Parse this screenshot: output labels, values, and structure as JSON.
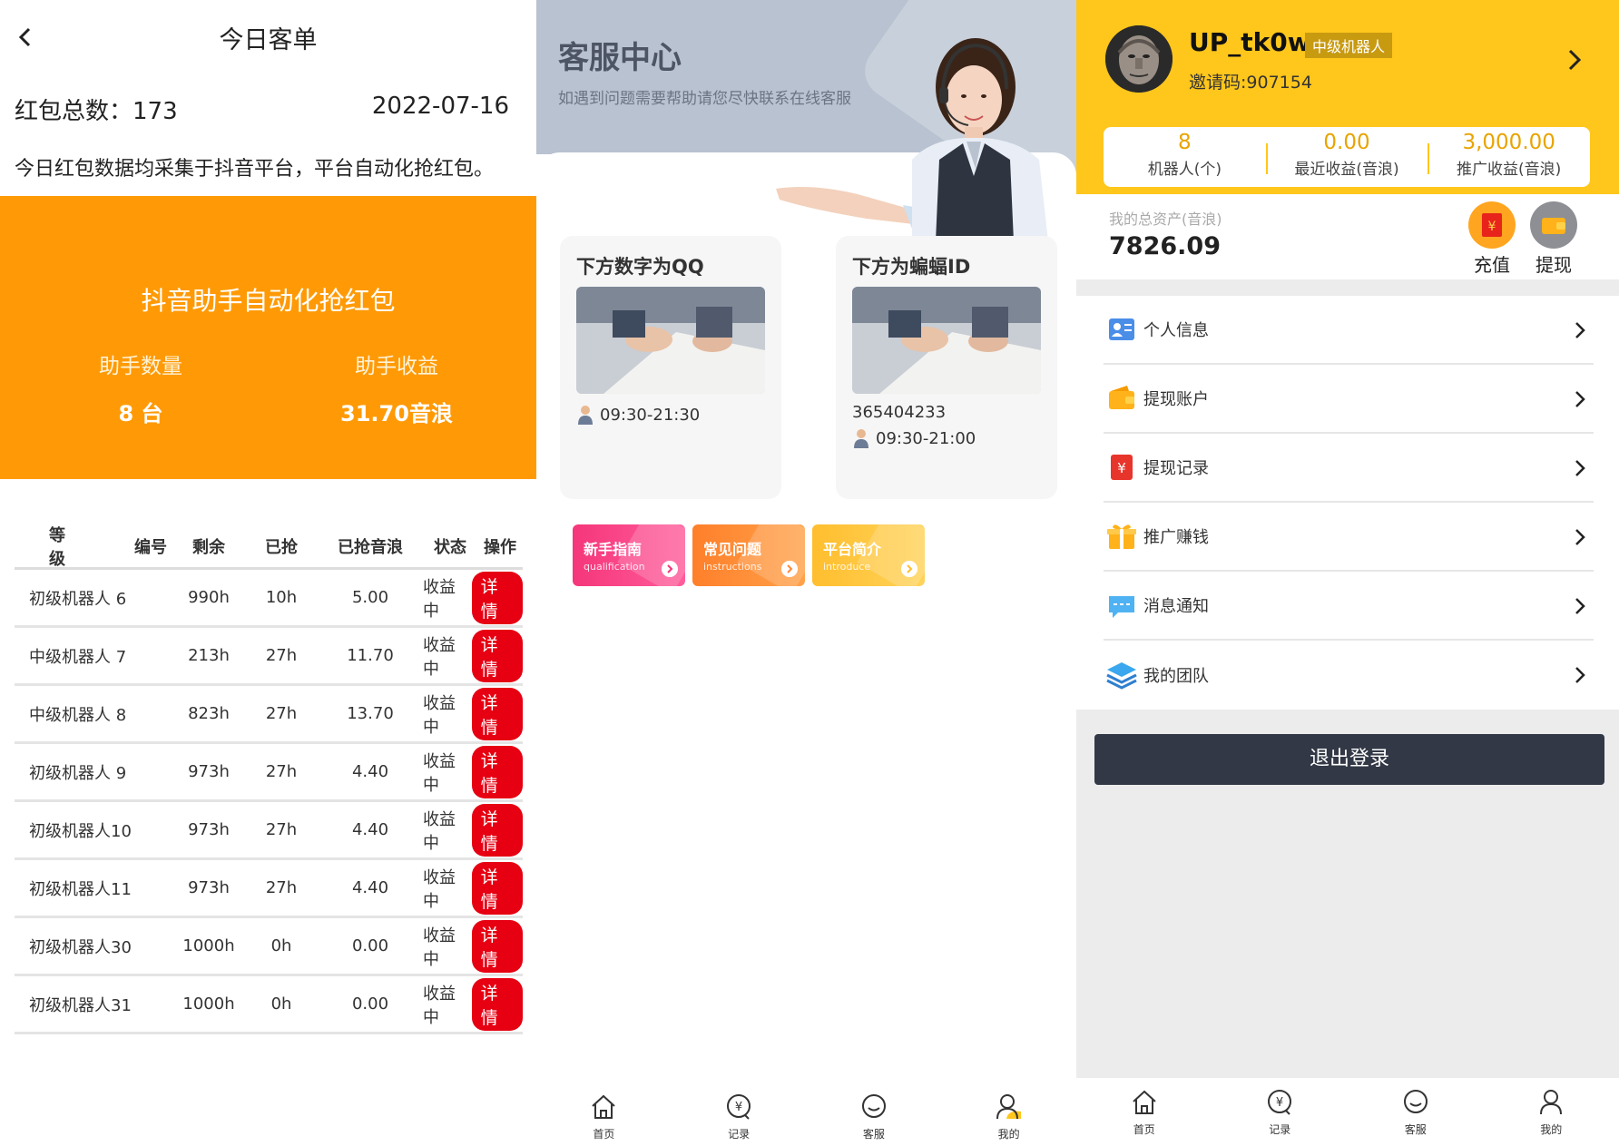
{
  "panel1": {
    "title": "今日客单",
    "total_label": "红包总数：173",
    "date": "2022-07-16",
    "note": "今日红包数据均采集于抖音平台，平台自动化抢红包。",
    "banner": {
      "title": "抖音助手自动化抢红包",
      "count_label": "助手数量",
      "count_value": "8 台",
      "income_label": "助手收益",
      "income_value": "31.70音浪"
    },
    "table": {
      "headers": [
        "等级",
        "编号",
        "剩余",
        "已抢",
        "已抢音浪",
        "状态",
        "操作"
      ],
      "rows": [
        {
          "level": "初级机器人 6",
          "remain": "990h",
          "got": "10h",
          "amount": "5.00",
          "status": "收益中",
          "op": "详情"
        },
        {
          "level": "中级机器人 7",
          "remain": "213h",
          "got": "27h",
          "amount": "11.70",
          "status": "收益中",
          "op": "详情"
        },
        {
          "level": "中级机器人 8",
          "remain": "823h",
          "got": "27h",
          "amount": "13.70",
          "status": "收益中",
          "op": "详情"
        },
        {
          "level": "初级机器人 9",
          "remain": "973h",
          "got": "27h",
          "amount": "4.40",
          "status": "收益中",
          "op": "详情"
        },
        {
          "level": "初级机器人10",
          "remain": "973h",
          "got": "27h",
          "amount": "4.40",
          "status": "收益中",
          "op": "详情"
        },
        {
          "level": "初级机器人11",
          "remain": "973h",
          "got": "27h",
          "amount": "4.40",
          "status": "收益中",
          "op": "详情"
        },
        {
          "level": "初级机器人30",
          "remain": "1000h",
          "got": "0h",
          "amount": "0.00",
          "status": "收益中",
          "op": "详情"
        },
        {
          "level": "初级机器人31",
          "remain": "1000h",
          "got": "0h",
          "amount": "0.00",
          "status": "收益中",
          "op": "详情"
        }
      ]
    }
  },
  "panel2": {
    "title": "客服中心",
    "subtitle": "如遇到问题需要帮助请您尽快联系在线客服",
    "card_qq": {
      "title": "下方数字为QQ",
      "hours": "09:30-21:30"
    },
    "card_bat": {
      "title": "下方为蝙蝠ID",
      "id": "365404233",
      "hours": "09:30-21:00"
    },
    "tiles": [
      {
        "title": "新手指南",
        "sub": "qualification",
        "color": "#f5367a"
      },
      {
        "title": "常见问题",
        "sub": "instructions",
        "color": "#ff8a3a"
      },
      {
        "title": "平台简介",
        "sub": "introduce",
        "color": "#ffc53d"
      }
    ],
    "tabs": [
      {
        "label": "首页",
        "icon": "home-icon"
      },
      {
        "label": "记录",
        "icon": "yuan-record-icon"
      },
      {
        "label": "客服",
        "icon": "chat-bubble-icon"
      },
      {
        "label": "我的",
        "icon": "user-icon"
      }
    ]
  },
  "panel3": {
    "username": "UP_tk0w",
    "level": "中级机器人",
    "invite": "邀请码:907154",
    "stats": [
      {
        "value": "8",
        "label": "机器人(个)"
      },
      {
        "value": "0.00",
        "label": "最近收益(音浪)"
      },
      {
        "value": "3,000.00",
        "label": "推广收益(音浪)"
      }
    ],
    "assets_label": "我的总资产(音浪)",
    "assets_value": "7826.09",
    "recharge_label": "充值",
    "withdraw_label": "提现",
    "menu": [
      {
        "label": "个人信息",
        "icon": "id-card-icon"
      },
      {
        "label": "提现账户",
        "icon": "wallet-icon"
      },
      {
        "label": "提现记录",
        "icon": "yuan-list-icon"
      },
      {
        "label": "推广赚钱",
        "icon": "gift-icon"
      },
      {
        "label": "消息通知",
        "icon": "message-icon"
      },
      {
        "label": "我的团队",
        "icon": "layers-icon"
      }
    ],
    "logout": "退出登录",
    "tabs": [
      {
        "label": "首页",
        "icon": "home-icon"
      },
      {
        "label": "记录",
        "icon": "yuan-record-icon"
      },
      {
        "label": "客服",
        "icon": "chat-bubble-icon"
      },
      {
        "label": "我的",
        "icon": "user-icon"
      }
    ]
  },
  "colors": {
    "orange_banner": "#ff9a06",
    "yellow_header": "#ffc61c",
    "detail_red": "#e60012",
    "logout_dark": "#323846"
  }
}
